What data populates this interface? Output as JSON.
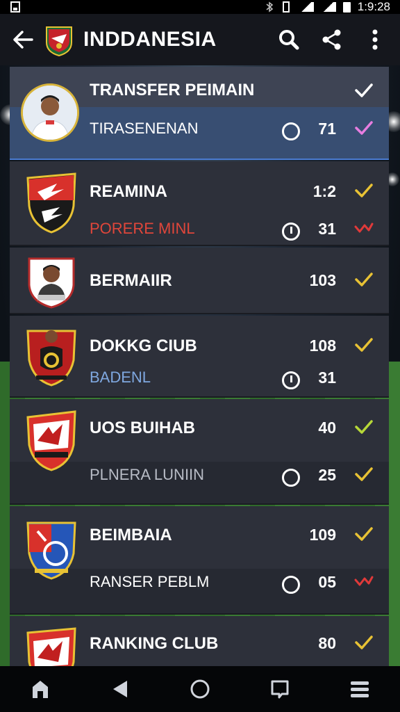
{
  "status_bar": {
    "time": "1:9:28"
  },
  "header": {
    "title": "INDDANESIA"
  },
  "colors": {
    "accent_gold": "#e8c234",
    "check_white": "#ffffff",
    "check_pink": "#e77de0",
    "check_red": "#e03a3a",
    "check_lime": "#b7d838",
    "highlight": "#4a7bd0"
  },
  "list": [
    {
      "title": "TRANSFER PEIMAIN",
      "subtitle": "TIRASENENAN",
      "value_top": "",
      "value_bottom": "71",
      "check_top": "white",
      "check_bottom": "pink"
    },
    {
      "title": "REAMINA",
      "subtitle": "PORERE MINL",
      "value_top": "1:2",
      "value_bottom": "31",
      "check_top": "gold",
      "check_bottom": "red-double"
    },
    {
      "title": "BERMAIIR",
      "subtitle": "",
      "value_top": "103",
      "value_bottom": "",
      "check_top": "gold",
      "check_bottom": ""
    },
    {
      "title": "DOKKG CIUB",
      "subtitle": "BADENL",
      "value_top": "108",
      "value_bottom": "31",
      "check_top": "gold",
      "check_bottom": ""
    },
    {
      "title": "UOS BUIHAB",
      "subtitle": "PLNERA LUNIIN",
      "value_top": "40",
      "value_bottom": "25",
      "check_top": "lime",
      "check_bottom": "gold"
    },
    {
      "title": "BEIMBAIA",
      "subtitle": "RANSER PEBLM",
      "value_top": "109",
      "value_bottom": "05",
      "check_top": "gold",
      "check_bottom": "red-double"
    },
    {
      "title": "RANKING CLUB",
      "subtitle": "",
      "value_top": "80",
      "value_bottom": "",
      "check_top": "gold",
      "check_bottom": ""
    }
  ],
  "icons": {
    "back": "arrow-left-icon",
    "search": "search-icon",
    "share": "share-icon",
    "more": "more-vert-icon",
    "nav_home": "home-icon",
    "nav_back": "triangle-back-icon",
    "nav_circle": "circle-home-icon",
    "nav_recent": "square-recent-icon",
    "nav_menu": "menu-icon"
  }
}
